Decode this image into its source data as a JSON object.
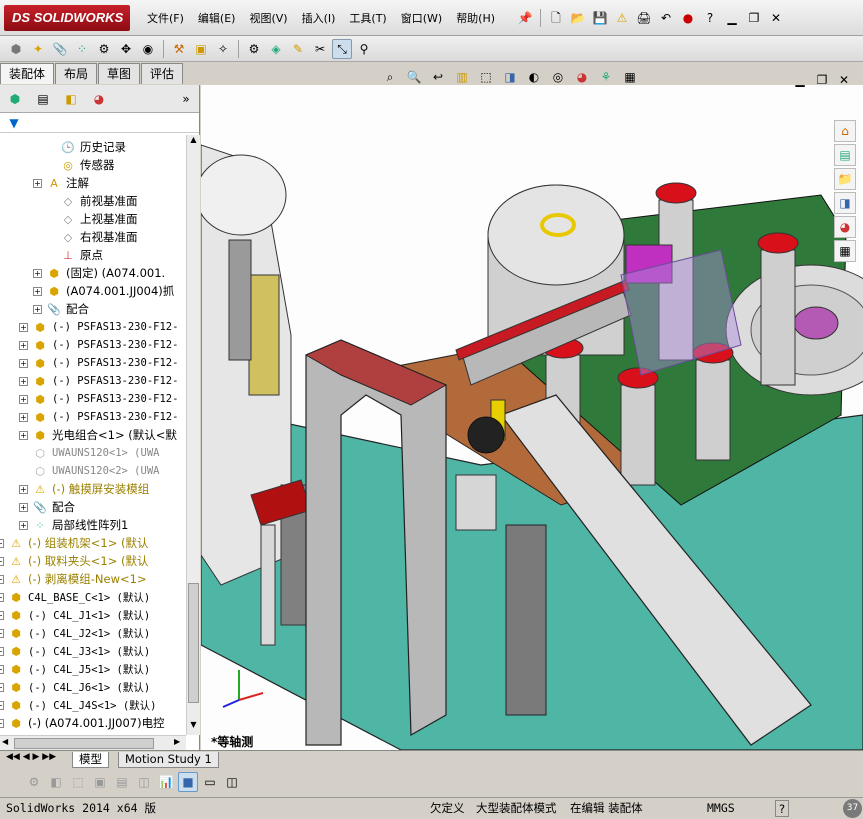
{
  "app": {
    "logo_text": "SOLIDWORKS",
    "logo_prefix": "DS"
  },
  "menu": [
    "文件(F)",
    "编辑(E)",
    "视图(V)",
    "插入(I)",
    "工具(T)",
    "窗口(W)",
    "帮助(H)"
  ],
  "command_tabs": [
    "装配体",
    "布局",
    "草图",
    "评估"
  ],
  "tree": [
    {
      "label": "历史记录",
      "icon": "history-icon"
    },
    {
      "label": "传感器",
      "icon": "sensor-icon"
    },
    {
      "label": "注解",
      "icon": "annotation-icon"
    },
    {
      "label": "前视基准面",
      "icon": "plane-icon"
    },
    {
      "label": "上视基准面",
      "icon": "plane-icon"
    },
    {
      "label": "右视基准面",
      "icon": "plane-icon"
    },
    {
      "label": "原点",
      "icon": "origin-icon"
    },
    {
      "label": "(固定) (A074.001.",
      "icon": "part-icon"
    },
    {
      "label": "(A074.001.JJ004)抓",
      "icon": "part-icon"
    },
    {
      "label": "配合",
      "icon": "mate-icon"
    },
    {
      "label": "(-) PSFAS13-230-F12-",
      "icon": "part-icon"
    },
    {
      "label": "(-) PSFAS13-230-F12-",
      "icon": "part-icon"
    },
    {
      "label": "(-) PSFAS13-230-F12-",
      "icon": "part-icon"
    },
    {
      "label": "(-) PSFAS13-230-F12-",
      "icon": "part-icon"
    },
    {
      "label": "(-) PSFAS13-230-F12-",
      "icon": "part-icon"
    },
    {
      "label": "(-) PSFAS13-230-F12-",
      "icon": "part-icon"
    },
    {
      "label": "光电组合<1> (默认<默",
      "icon": "assembly-icon"
    },
    {
      "label": "UWAUNS120<1> (UWA",
      "icon": "suppressed-part-icon"
    },
    {
      "label": "UWAUNS120<2> (UWA",
      "icon": "suppressed-part-icon"
    },
    {
      "label": "(-) 触摸屏安装模组",
      "icon": "warning-icon"
    },
    {
      "label": "配合",
      "icon": "mate-icon"
    },
    {
      "label": "局部线性阵列1",
      "icon": "pattern-icon"
    },
    {
      "label": "(-) 组装机架<1> (默认",
      "icon": "warning-icon"
    },
    {
      "label": "(-) 取料夹头<1> (默认",
      "icon": "warning-icon"
    },
    {
      "label": "(-) 剥离模组-New<1>",
      "icon": "warning-icon"
    },
    {
      "label": "C4L_BASE_C<1> (默认)",
      "icon": "part-icon"
    },
    {
      "label": "(-) C4L_J1<1> (默认)",
      "icon": "part-icon"
    },
    {
      "label": "(-) C4L_J2<1> (默认)",
      "icon": "part-icon"
    },
    {
      "label": "(-) C4L_J3<1> (默认)",
      "icon": "part-icon"
    },
    {
      "label": "(-) C4L_J5<1> (默认)",
      "icon": "part-icon"
    },
    {
      "label": "(-) C4L_J6<1> (默认)",
      "icon": "part-icon"
    },
    {
      "label": "(-) C4L_J4S<1> (默认)",
      "icon": "part-icon"
    },
    {
      "label": "(-) (A074.001.JJ007)电控",
      "icon": "part-icon"
    }
  ],
  "bottom_tabs": [
    "模型",
    "Motion Study 1"
  ],
  "view_label": "*等轴测",
  "status": {
    "app_version": "SolidWorks 2014 x64 版",
    "undefined": "欠定义",
    "large_mode": "大型装配体模式",
    "editing": "在编辑 装配体",
    "units": "MMGS",
    "help": "?",
    "badge": "37"
  },
  "colors": {
    "brand": "#b3141c",
    "floor": "#4fb5a5",
    "plate": "#b36a3a",
    "green": "#2f7a3a",
    "red_button": "#d8101a"
  }
}
